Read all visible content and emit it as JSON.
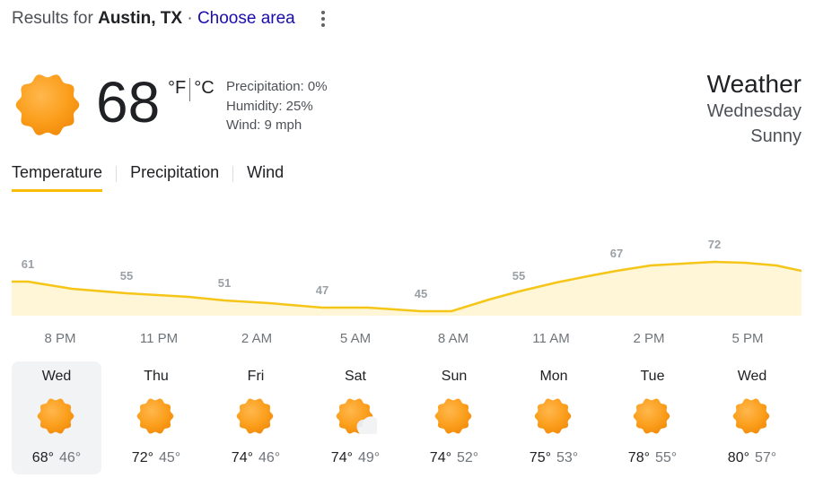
{
  "header": {
    "results_prefix": "Results for",
    "city": "Austin, TX",
    "separator": "·",
    "choose_area": "Choose area"
  },
  "current": {
    "icon": "sunny-icon",
    "temperature": "68",
    "unit_f": "°F",
    "unit_c": "°C",
    "precipitation": "Precipitation: 0%",
    "humidity": "Humidity: 25%",
    "wind": "Wind: 9 mph"
  },
  "summary": {
    "title": "Weather",
    "day": "Wednesday",
    "condition": "Sunny"
  },
  "tabs": [
    {
      "label": "Temperature",
      "active": true
    },
    {
      "label": "Precipitation",
      "active": false
    },
    {
      "label": "Wind",
      "active": false
    }
  ],
  "chart_data": {
    "type": "area",
    "x": [
      "8 PM",
      "11 PM",
      "2 AM",
      "5 AM",
      "8 AM",
      "11 AM",
      "2 PM",
      "5 PM"
    ],
    "values": [
      61,
      55,
      51,
      47,
      45,
      55,
      67,
      72
    ],
    "unit": "°F",
    "line_color": "#f5c518",
    "fill_color": "#fef6d6"
  },
  "hours": [
    "8 PM",
    "11 PM",
    "2 AM",
    "5 AM",
    "8 AM",
    "11 AM",
    "2 PM",
    "5 PM"
  ],
  "days": [
    {
      "name": "Wed",
      "high": "68°",
      "low": "46°",
      "icon": "sunny-icon",
      "selected": true
    },
    {
      "name": "Thu",
      "high": "72°",
      "low": "45°",
      "icon": "sunny-icon",
      "selected": false
    },
    {
      "name": "Fri",
      "high": "74°",
      "low": "46°",
      "icon": "sunny-icon",
      "selected": false
    },
    {
      "name": "Sat",
      "high": "74°",
      "low": "49°",
      "icon": "partly-cloudy-icon",
      "selected": false
    },
    {
      "name": "Sun",
      "high": "74°",
      "low": "52°",
      "icon": "sunny-icon",
      "selected": false
    },
    {
      "name": "Mon",
      "high": "75°",
      "low": "53°",
      "icon": "sunny-icon",
      "selected": false
    },
    {
      "name": "Tue",
      "high": "78°",
      "low": "55°",
      "icon": "sunny-icon",
      "selected": false
    },
    {
      "name": "Wed",
      "high": "80°",
      "low": "57°",
      "icon": "sunny-icon",
      "selected": false
    }
  ],
  "colors": {
    "sun": "#fbbc04",
    "link": "#1a0dab",
    "tab_underline": "#fbbc04"
  }
}
